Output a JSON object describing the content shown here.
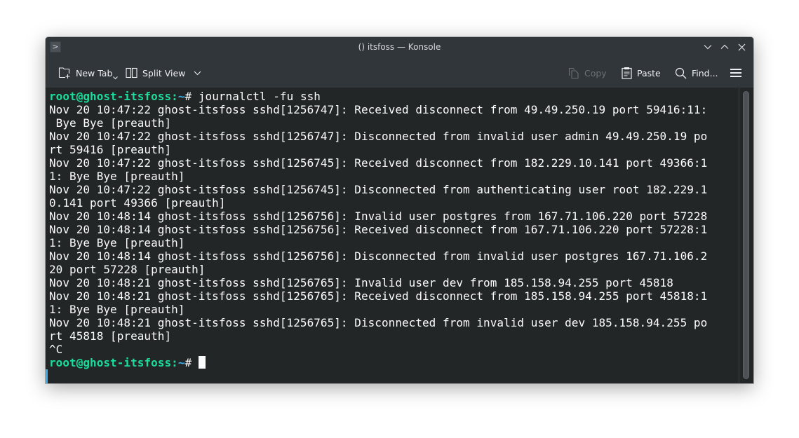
{
  "window": {
    "title": "() itsfoss — Konsole",
    "controls": [
      "minimize",
      "maximize",
      "close"
    ]
  },
  "toolbar": {
    "new_tab_label": "New Tab",
    "split_view_label": "Split View",
    "copy_label": "Copy",
    "paste_label": "Paste",
    "find_label": "Find..."
  },
  "terminal": {
    "prompt_user_host": "root@ghost-itsfoss",
    "prompt_sep": ":",
    "prompt_path": "~",
    "prompt_symbol": "# ",
    "command": "journalctl -fu ssh",
    "output_lines": [
      "Nov 20 10:47:22 ghost-itsfoss sshd[1256747]: Received disconnect from 49.49.250.19 port 59416:11:",
      " Bye Bye [preauth]",
      "Nov 20 10:47:22 ghost-itsfoss sshd[1256747]: Disconnected from invalid user admin 49.49.250.19 po",
      "rt 59416 [preauth]",
      "Nov 20 10:47:22 ghost-itsfoss sshd[1256745]: Received disconnect from 182.229.10.141 port 49366:1",
      "1: Bye Bye [preauth]",
      "Nov 20 10:47:22 ghost-itsfoss sshd[1256745]: Disconnected from authenticating user root 182.229.1",
      "0.141 port 49366 [preauth]",
      "Nov 20 10:48:14 ghost-itsfoss sshd[1256756]: Invalid user postgres from 167.71.106.220 port 57228",
      "Nov 20 10:48:14 ghost-itsfoss sshd[1256756]: Received disconnect from 167.71.106.220 port 57228:1",
      "1: Bye Bye [preauth]",
      "Nov 20 10:48:14 ghost-itsfoss sshd[1256756]: Disconnected from invalid user postgres 167.71.106.2",
      "20 port 57228 [preauth]",
      "Nov 20 10:48:21 ghost-itsfoss sshd[1256765]: Invalid user dev from 185.158.94.255 port 45818",
      "Nov 20 10:48:21 ghost-itsfoss sshd[1256765]: Received disconnect from 185.158.94.255 port 45818:1",
      "1: Bye Bye [preauth]",
      "Nov 20 10:48:21 ghost-itsfoss sshd[1256765]: Disconnected from invalid user dev 185.158.94.255 po",
      "rt 45818 [preauth]",
      "^C"
    ]
  },
  "colors": {
    "prompt_user": "#1cdc9a",
    "prompt_path": "#3daee9",
    "terminal_bg": "#232627",
    "terminal_fg": "#fcfcfc",
    "chrome_bg": "#31363b"
  }
}
